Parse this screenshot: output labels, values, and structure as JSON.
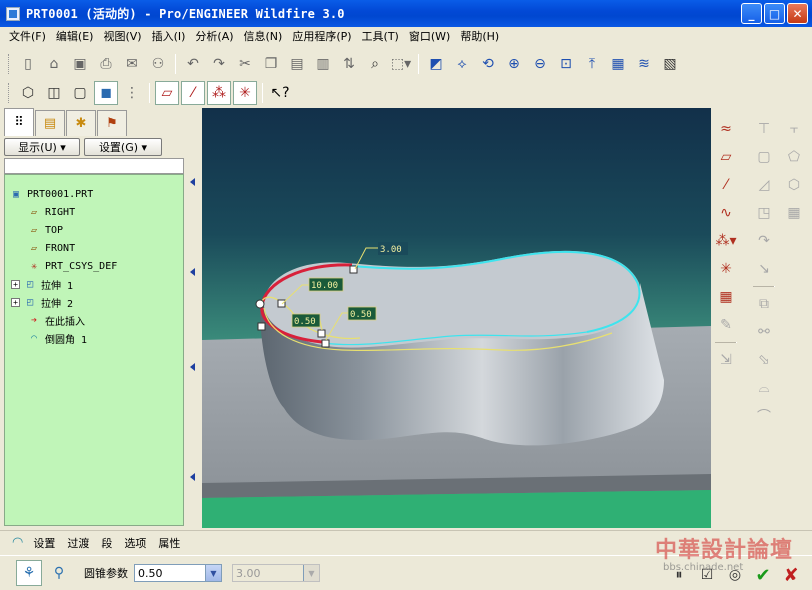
{
  "window": {
    "title": "PRT0001 (活动的) - Pro/ENGINEER Wildfire 3.0",
    "min_label": "_",
    "max_label": "□",
    "close_label": "✕"
  },
  "menu": [
    {
      "label": "文件(F)"
    },
    {
      "label": "编辑(E)"
    },
    {
      "label": "视图(V)"
    },
    {
      "label": "插入(I)"
    },
    {
      "label": "分析(A)"
    },
    {
      "label": "信息(N)"
    },
    {
      "label": "应用程序(P)"
    },
    {
      "label": "工具(T)"
    },
    {
      "label": "窗口(W)"
    },
    {
      "label": "帮助(H)"
    }
  ],
  "panel": {
    "show_button": "显示(U) ▾",
    "settings_button": "设置(G) ▾"
  },
  "tree": {
    "root": "PRT0001.PRT",
    "items": [
      {
        "label": "RIGHT",
        "icon": "datum-plane-icon"
      },
      {
        "label": "TOP",
        "icon": "datum-plane-icon"
      },
      {
        "label": "FRONT",
        "icon": "datum-plane-icon"
      },
      {
        "label": "PRT_CSYS_DEF",
        "icon": "csys-icon"
      },
      {
        "label": "拉伸 1",
        "icon": "extrude-icon",
        "expandable": true
      },
      {
        "label": "拉伸 2",
        "icon": "extrude-icon",
        "expandable": true
      },
      {
        "label": "在此插入",
        "icon": "insert-arrow-icon"
      },
      {
        "label": "倒圆角 1",
        "icon": "round-icon"
      }
    ]
  },
  "model": {
    "dim1": "3.00",
    "dim2": "10.00",
    "dim3": "0.50",
    "dim4": "0.50"
  },
  "dashboard": {
    "tabs": [
      "设置",
      "过渡",
      "段",
      "选项",
      "属性"
    ],
    "param_label": "圆锥参数",
    "conic_value": "0.50",
    "depth_value": "3.00"
  },
  "watermark": {
    "line1": "中華設計論壇",
    "line2": "bbs.chinade.net"
  },
  "colors": {
    "tree_bg": "#c0f5b8",
    "accent": "#0a5de8"
  }
}
